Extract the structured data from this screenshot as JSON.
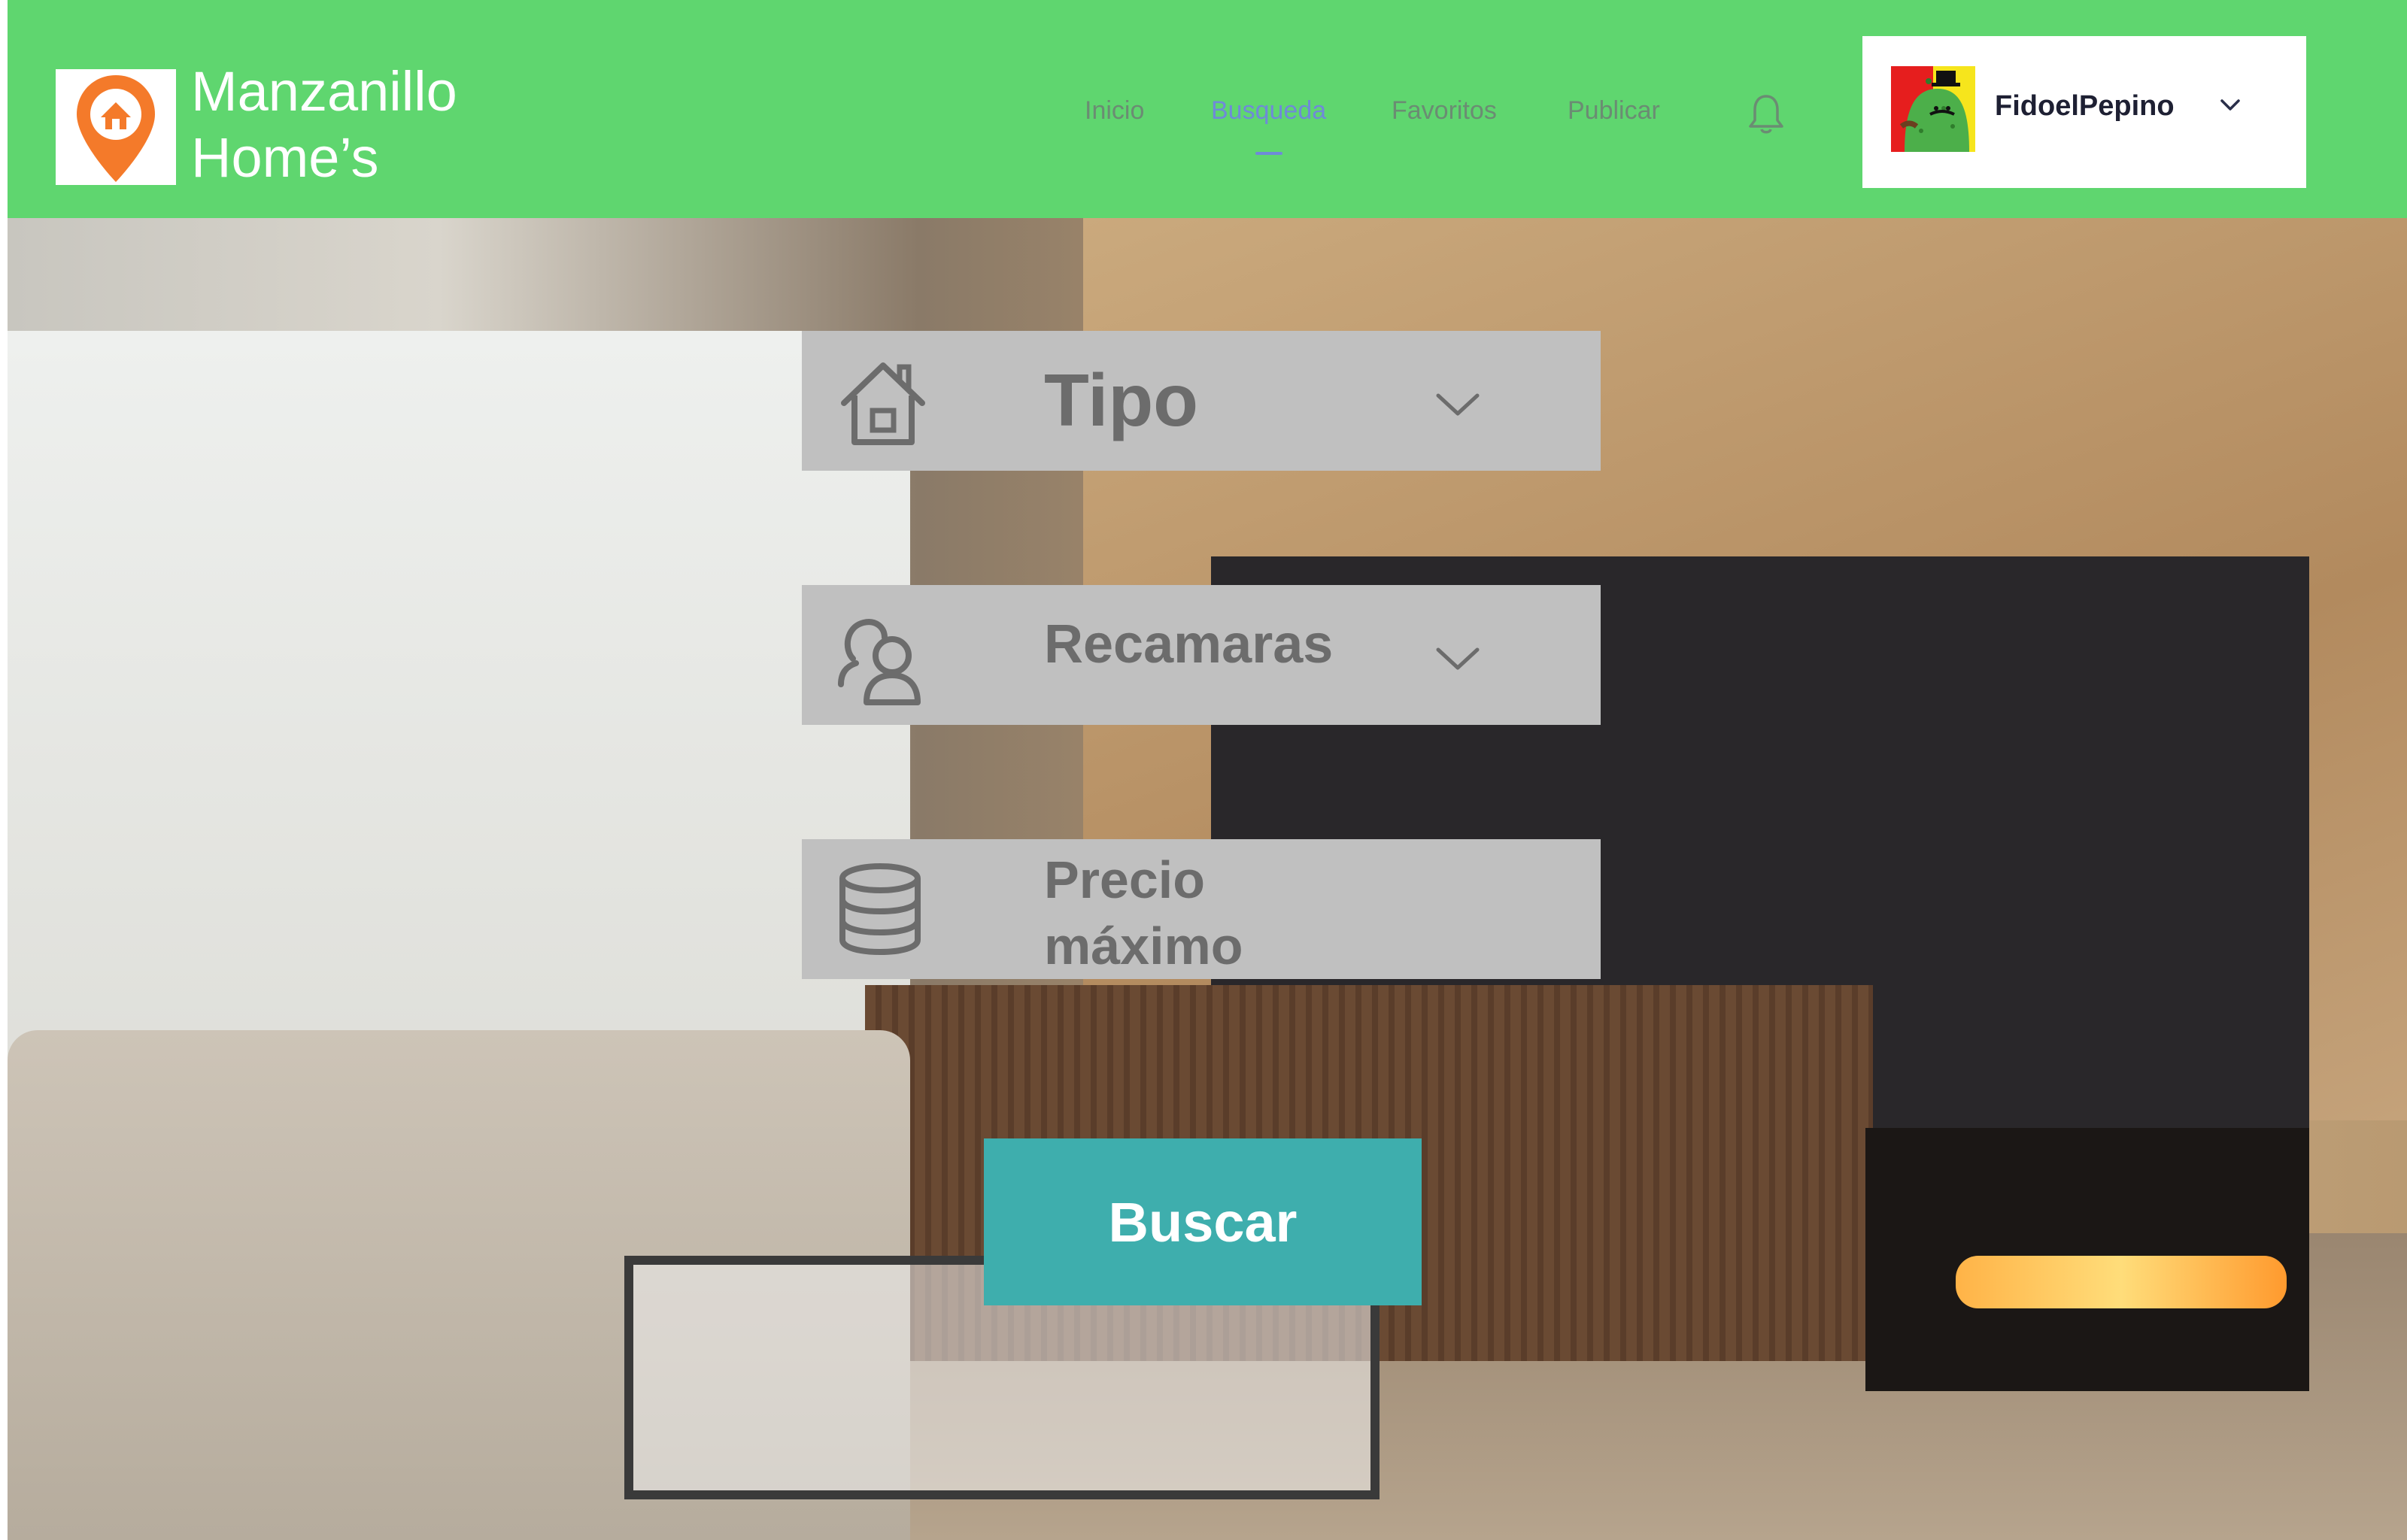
{
  "brand": {
    "line1": "Manzanillo",
    "line2": "Home’s",
    "logo_icon": "map-pin-home-icon"
  },
  "nav": {
    "items": [
      {
        "label": "Inicio",
        "active": false
      },
      {
        "label": "Busqueda",
        "active": true
      },
      {
        "label": "Favoritos",
        "active": false
      },
      {
        "label": "Publicar",
        "active": false
      }
    ],
    "notification_icon": "bell-icon"
  },
  "user": {
    "name": "FidoelPepino",
    "menu_icon": "chevron-down-icon"
  },
  "search": {
    "fields": [
      {
        "label": "Tipo",
        "icon": "house-icon",
        "has_dropdown": true
      },
      {
        "label": "Recamaras",
        "icon": "people-icon",
        "has_dropdown": true
      },
      {
        "label_line1": "Precio",
        "label_line2": "máximo",
        "icon": "database-icon",
        "has_dropdown": false
      }
    ],
    "submit_label": "Buscar"
  },
  "colors": {
    "header_bg": "#5fd66f",
    "accent_button": "#3eaead",
    "field_bg": "#c0c0c0",
    "nav_active": "#6f8ad8",
    "logo_orange": "#f47a2a"
  }
}
